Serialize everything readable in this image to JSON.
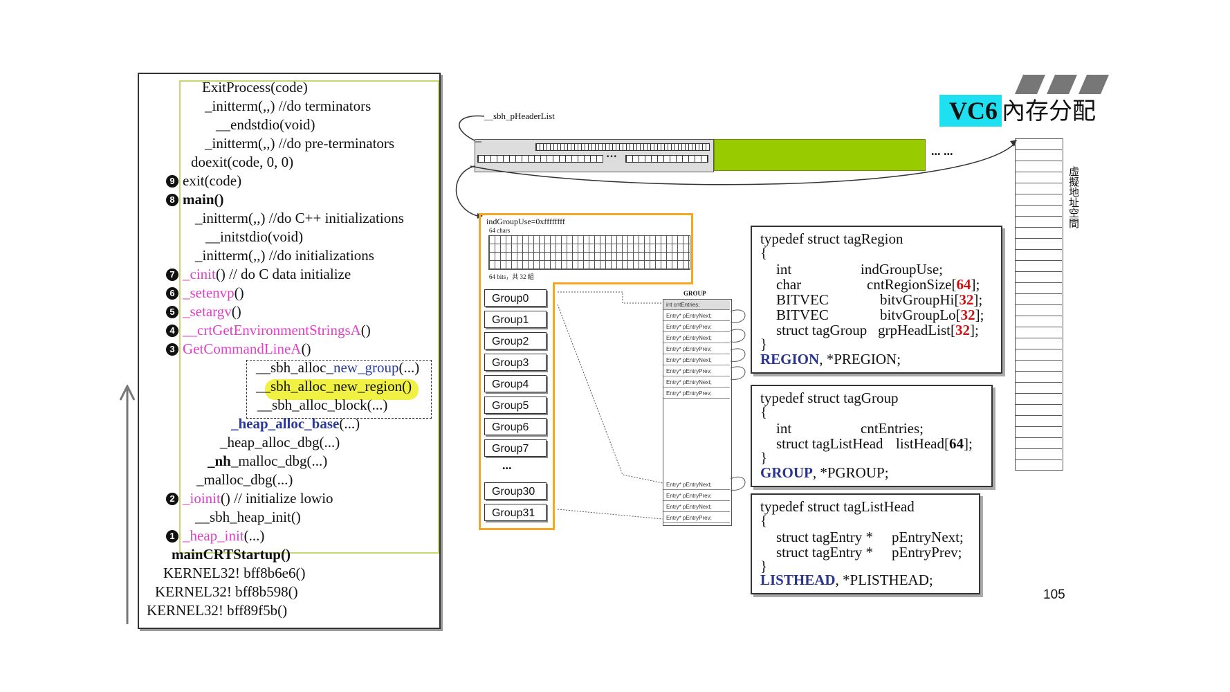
{
  "title": {
    "vc6": "VC6",
    "rest": "內存分配"
  },
  "page_number": "105",
  "vertical_label": "虛擬地址空間",
  "call_stack": [
    {
      "text": "ExitProcess(code)"
    },
    {
      "text": "_initterm(,,)    //do terminators"
    },
    {
      "text": "__endstdio(void)"
    },
    {
      "text": "_initterm(,,)    //do pre-terminators"
    },
    {
      "text": "doexit(code, 0, 0)"
    },
    {
      "badge": "9",
      "text": "exit(code)"
    },
    {
      "badge": "8",
      "text": "main()"
    },
    {
      "text": "_initterm(,,)   //do C++ initializations"
    },
    {
      "text": "__initstdio(void)"
    },
    {
      "text": "_initterm(,,)   //do initializations"
    },
    {
      "badge": "7",
      "fn": "_cinit",
      "text": "()   // do C data initialize"
    },
    {
      "badge": "6",
      "fn": "_setenvp",
      "text": "()"
    },
    {
      "badge": "5",
      "fn": "_setargv",
      "text": "()"
    },
    {
      "badge": "4",
      "fn": "__crtGetEnvironmentStringsA",
      "text": "()"
    },
    {
      "badge": "3",
      "fn": "GetCommandLineA",
      "text": "()"
    },
    {
      "pre": "__sbh_alloc_",
      "fn": "new_group",
      "text": "(...)"
    },
    {
      "text": "__sbh_alloc_new_region()"
    },
    {
      "text": "__sbh_alloc_block(...)"
    },
    {
      "fn": "_heap_alloc_base",
      "text": "(...)"
    },
    {
      "text": "_heap_alloc_dbg(...)"
    },
    {
      "fn": "_nh",
      "text": "_malloc_dbg(...)"
    },
    {
      "text": "_malloc_dbg(...)"
    },
    {
      "badge": "2",
      "fn": "_ioinit",
      "text": "()  // initialize lowio"
    },
    {
      "text": "__sbh_heap_init()"
    },
    {
      "badge": "1",
      "fn": "_heap_init",
      "text": "(...)"
    },
    {
      "text": "mainCRTStartup()"
    },
    {
      "text": "KERNEL32! bff8b6e6()"
    },
    {
      "text": "KERNEL32! bff8b598()"
    },
    {
      "text": "KERNEL32! bff89f5b()"
    }
  ],
  "diagram": {
    "header_list_label": "__sbh_pHeaderList",
    "ellipsis_right": "... ...",
    "ellipsis_mid": "...",
    "ind_group_use": "indGroupUse=0xffffffff",
    "chars_label": "64 chars",
    "bits_label": "64 bits，共 32 組",
    "group_label": "GROUP",
    "cnt_entries": "int  cntEntries;",
    "entry_next": "Entry*  pEntryNext;",
    "entry_prev": "Entry*  pEntryPrev;",
    "groups": [
      "Group0",
      "Group1",
      "Group2",
      "Group3",
      "Group4",
      "Group5",
      "Group6",
      "Group7",
      "...",
      "Group30",
      "Group31"
    ]
  },
  "region_struct": {
    "l1": "typedef struct tagRegion",
    "l2": "{",
    "l3a": "int",
    "l3b": "indGroupUse;",
    "l4a": "char",
    "l4b": "cntRegionSize[",
    "l4n": "64",
    "l4c": "];",
    "l5a": "BITVEC",
    "l5b": "bitvGroupHi[",
    "l5n": "32",
    "l5c": "];",
    "l6a": "BITVEC",
    "l6b": "bitvGroupLo[",
    "l6n": "32",
    "l6c": "];",
    "l7a": "struct tagGroup",
    "l7b": "grpHeadList[",
    "l7n": "32",
    "l7c": "];",
    "l8": "}",
    "name": "REGION",
    "rest": ", *PREGION;"
  },
  "group_struct": {
    "l1": "typedef struct tagGroup",
    "l2": "{",
    "l3a": "int",
    "l3b": "cntEntries;",
    "l4a": "struct tagListHead",
    "l4b": "listHead[",
    "l4n": "64",
    "l4c": "];",
    "l5": "}",
    "name": "GROUP",
    "rest": ", *PGROUP;"
  },
  "listhead_struct": {
    "l1": "typedef struct tagListHead",
    "l2": "{",
    "l3a": "struct tagEntry *",
    "l3b": "pEntryNext;",
    "l4a": "struct tagEntry *",
    "l4b": "pEntryPrev;",
    "l5": "}",
    "name": "LISTHEAD",
    "rest": ", *PLISTHEAD;"
  },
  "colors": {
    "cyan": "#1fe0f0",
    "green": "#99cc00",
    "orange": "#f5a623",
    "pink": "#e040c8",
    "navy": "#2a3590",
    "red": "#d01010",
    "highlight": "#f0f030"
  }
}
